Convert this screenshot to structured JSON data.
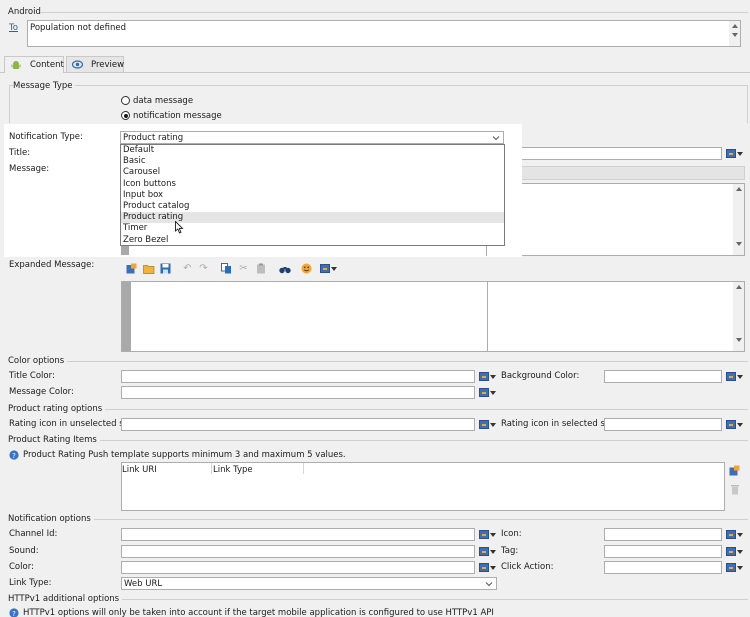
{
  "header": {
    "section_title": "Android",
    "to_link": "To",
    "to_value": "Population not defined"
  },
  "tabs": [
    {
      "label": "Content"
    },
    {
      "label": "Preview"
    }
  ],
  "message_type": {
    "group_label": "Message Type",
    "options": [
      {
        "label": "data message",
        "selected": false
      },
      {
        "label": "notification message",
        "selected": true
      }
    ]
  },
  "form": {
    "notification_type_label": "Notification Type:",
    "notification_type_value": "Product rating",
    "title_label": "Title:",
    "message_label": "Message:",
    "expanded_message_label": "Expanded Message:"
  },
  "dropdown": {
    "items": [
      {
        "label": "Default"
      },
      {
        "label": "Basic"
      },
      {
        "label": "Carousel"
      },
      {
        "label": "Icon buttons"
      },
      {
        "label": "Input box"
      },
      {
        "label": "Product catalog"
      },
      {
        "label": "Product rating"
      },
      {
        "label": "Timer"
      },
      {
        "label": "Zero Bezel"
      }
    ],
    "highlighted": "Product rating"
  },
  "color_options": {
    "group_label": "Color options",
    "title_color_label": "Title Color:",
    "background_color_label": "Background Color:",
    "message_color_label": "Message Color:"
  },
  "product_rating_options": {
    "group_label": "Product rating options",
    "unselected_label": "Rating icon in unselected state:",
    "selected_label": "Rating icon in selected state:"
  },
  "product_rating_items": {
    "group_label": "Product Rating Items",
    "info_text": "Product Rating Push template supports minimum 3 and maximum 5 values.",
    "columns": [
      "Link URI",
      "Link Type"
    ]
  },
  "notification_options": {
    "group_label": "Notification options",
    "channel_id_label": "Channel Id:",
    "icon_label": "Icon:",
    "sound_label": "Sound:",
    "tag_label": "Tag:",
    "color_label": "Color:",
    "click_action_label": "Click Action:",
    "link_type_label": "Link Type:",
    "link_type_value": "Web URL"
  },
  "httpv1": {
    "group_label": "HTTPv1 additional options",
    "info_text": "HTTPv1 options will only be taken into account if the target mobile application is configured to use HTTPv1 API"
  },
  "colors": {
    "accent": "#3d6fb3",
    "warning": "#f3a533",
    "info": "#3b73c4"
  }
}
